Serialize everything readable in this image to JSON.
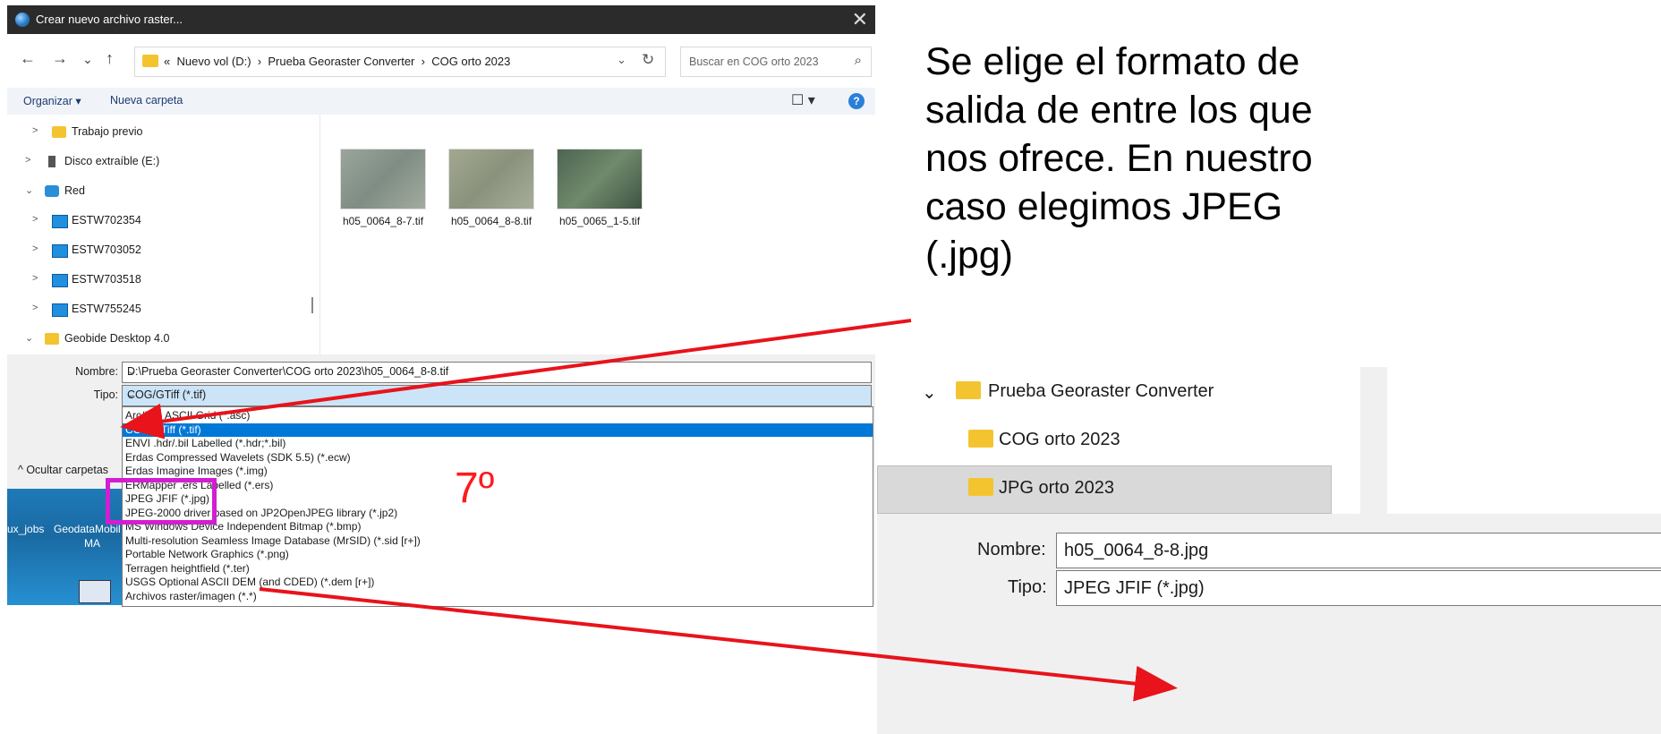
{
  "window": {
    "title": "Crear nuevo archivo raster...",
    "close_glyph": "✕"
  },
  "address": {
    "path_prefix": "«",
    "segments": [
      "Nuevo vol (D:)",
      "Prueba Georaster Converter",
      "COG orto 2023"
    ],
    "separator": "›"
  },
  "search": {
    "placeholder": "Buscar en COG orto 2023"
  },
  "toolbar": {
    "organize_label": "Organizar ▾",
    "new_folder_label": "Nueva carpeta",
    "view_glyph": "☐ ▾",
    "help_glyph": "?"
  },
  "nav_glyphs": {
    "back": "←",
    "forward": "→",
    "recent": "⌄",
    "up": "↑"
  },
  "navpane": {
    "items": [
      {
        "label": "Trabajo previo",
        "icon": "folder-icon",
        "expanded": false
      },
      {
        "label": "Disco extraíble (E:)",
        "icon": "usb-drive-icon",
        "expanded": false
      },
      {
        "label": "Red",
        "icon": "network-icon",
        "expanded": true
      },
      {
        "label": "ESTW702354",
        "icon": "computer-icon",
        "expanded": false
      },
      {
        "label": "ESTW703052",
        "icon": "computer-icon",
        "expanded": false
      },
      {
        "label": "ESTW703518",
        "icon": "computer-icon",
        "expanded": false
      },
      {
        "label": "ESTW755245",
        "icon": "computer-icon",
        "expanded": false
      },
      {
        "label": "Geobide Desktop 4.0",
        "icon": "folder-icon",
        "expanded": true
      }
    ]
  },
  "files": [
    {
      "name": "h05_0064_8-7.tif",
      "thumb_color": "#8d9a92"
    },
    {
      "name": "h05_0064_8-8.tif",
      "thumb_color": "#949d8a"
    },
    {
      "name": "h05_0065_1-5.tif",
      "thumb_color": "#5f7462"
    }
  ],
  "form": {
    "nombre_label": "Nombre:",
    "nombre_value": "D:\\Prueba Georaster Converter\\COG orto 2023\\h05_0064_8-8.tif",
    "tipo_label": "Tipo:",
    "tipo_value": "COG/GTiff (*.tif)",
    "hide_folders_label": "^ Ocultar carpetas"
  },
  "type_options": [
    "Arc/Info ASCII Grid (*.asc)",
    "COG/GTiff (*.tif)",
    "ENVI .hdr/.bil Labelled (*.hdr;*.bil)",
    "Erdas Compressed Wavelets (SDK 5.5) (*.ecw)",
    "Erdas Imagine Images (*.img)",
    "ERMapper .ers Labelled (*.ers)",
    "JPEG JFIF (*.jpg)",
    "JPEG-2000 driver based on JP2OpenJPEG library (*.jp2)",
    "MS Windows Device Independent Bitmap (*.bmp)",
    "Multi-resolution Seamless Image Database (MrSID) (*.sid [r+])",
    "Portable Network Graphics (*.png)",
    "Terragen heightfield (*.ter)",
    "USGS Optional ASCII DEM (and CDED) (*.dem [r+])",
    "Archivos raster/imagen (*.*)"
  ],
  "selected_option_index": 1,
  "desktop": {
    "icons": [
      "ux_jobs",
      "GeodataMobil",
      "MA"
    ]
  },
  "annotation": {
    "text": "Se elige el formato de salida de entre los que nos ofrece. En nuestro caso elegimos JPEG (.jpg)",
    "step_label": "7º",
    "arrow_color": "#e8131b",
    "highlight_color": "#d21ed2"
  },
  "zoom": {
    "tree": [
      {
        "label": "Prueba Georaster Converter",
        "expanded": true
      },
      {
        "label": "COG orto 2023"
      },
      {
        "label": "JPG orto 2023",
        "selected": true
      }
    ],
    "nombre_label": "Nombre:",
    "nombre_value": "h05_0064_8-8.jpg",
    "tipo_label": "Tipo:",
    "tipo_value": "JPEG JFIF (*.jpg)"
  }
}
